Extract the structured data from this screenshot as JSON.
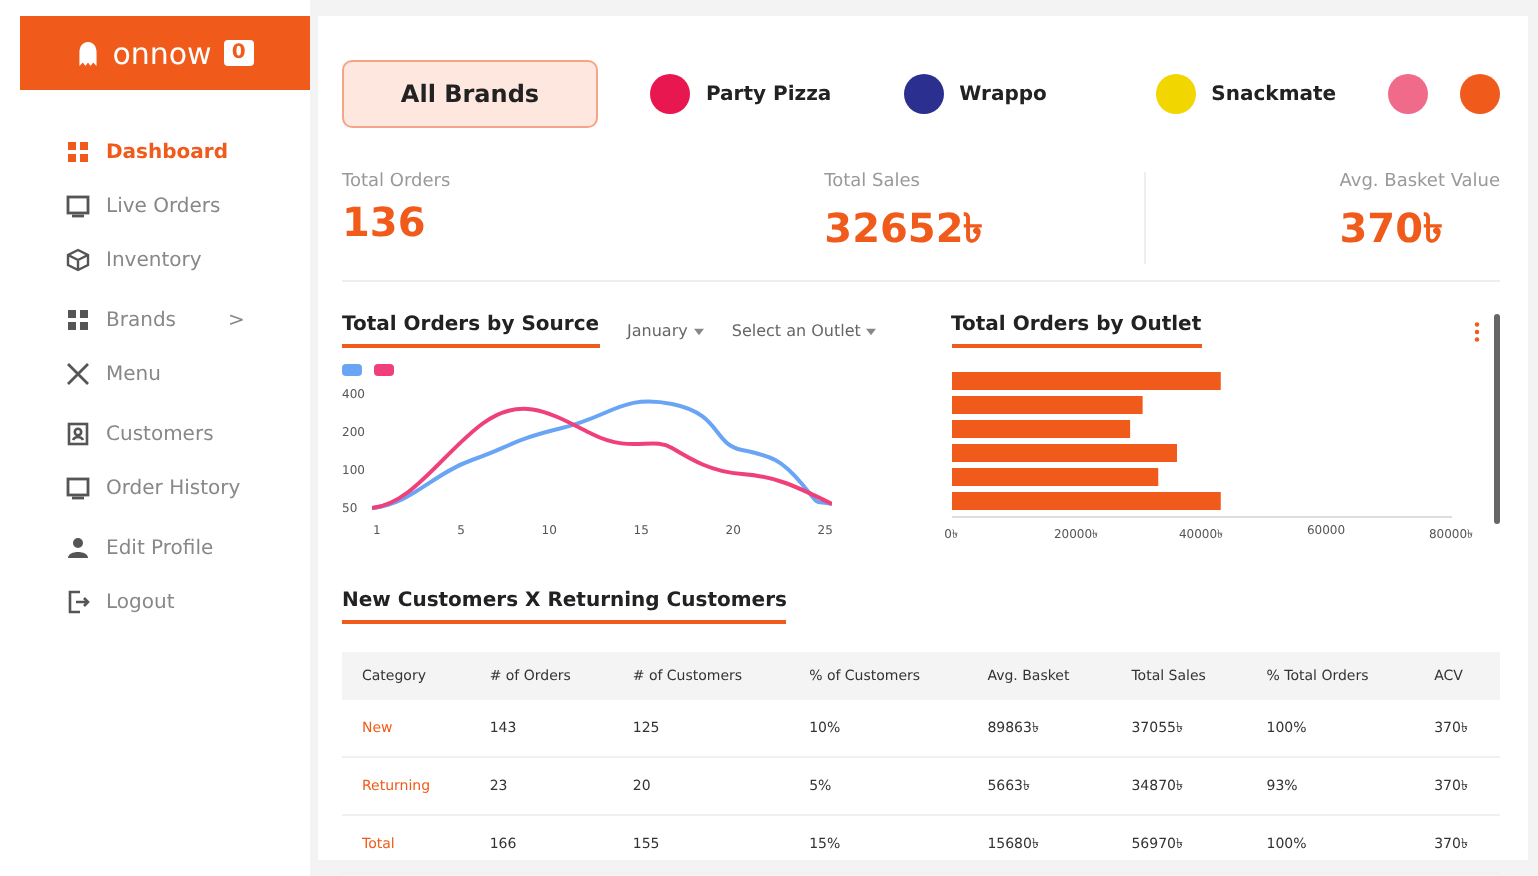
{
  "logo": {
    "name": "onnow",
    "badge": "0"
  },
  "sidebar": {
    "groups": [
      {
        "items": [
          {
            "label": "Dashboard",
            "selected": true
          },
          {
            "label": "Live Orders",
            "selected": false
          },
          {
            "label": "Inventory",
            "selected": false
          }
        ]
      },
      {
        "items": [
          {
            "label": "Brands",
            "selected": false,
            "chevron": ">"
          },
          {
            "label": "Menu",
            "selected": false
          }
        ]
      },
      {
        "items": [
          {
            "label": "Customers",
            "selected": false
          },
          {
            "label": "Order History",
            "selected": false
          }
        ]
      },
      {
        "items": [
          {
            "label": "Edit Profile",
            "selected": false
          },
          {
            "label": "Logout",
            "selected": false
          }
        ]
      }
    ]
  },
  "brands": [
    {
      "label": "All Brands",
      "selected": true
    },
    {
      "label": "Party Pizza",
      "selected": false,
      "color": "#e8174f"
    },
    {
      "label": "Wrappo",
      "selected": false,
      "color": "#2b2f8f"
    },
    {
      "label": "Snackmate",
      "selected": false,
      "color": "#f2d600"
    },
    {
      "selected": false,
      "color": "#f06b8a"
    },
    {
      "selected": false,
      "color": "#f05a1a"
    }
  ],
  "stats": [
    {
      "label": "Total Orders",
      "value": "136"
    },
    {
      "label": "Total Sales",
      "value": "32652৳"
    },
    {
      "label": "Avg. Basket Value",
      "value": "370৳"
    }
  ],
  "source_chart": {
    "title": "Total Orders by Source",
    "filters": [
      "January",
      "Select an Outlet"
    ],
    "y_ticks": [
      "400",
      "200",
      "100",
      "50"
    ],
    "x_ticks": [
      "1",
      "5",
      "10",
      "15",
      "20",
      "25"
    ]
  },
  "outlet_chart": {
    "title": "Total Orders by Outlet",
    "chart_data": {
      "type": "bar",
      "orientation": "horizontal",
      "categories": [
        null,
        null,
        null,
        null,
        null,
        null
      ],
      "xlim": [
        0,
        80000
      ],
      "xticks": [
        {
          "value": 0,
          "label": "0৳"
        },
        {
          "value": 20000,
          "label": "20000৳"
        },
        {
          "value": 40000,
          "label": "40000৳"
        },
        {
          "value": 60000,
          "label": "60000"
        },
        {
          "value": 80000,
          "label": "80000৳"
        }
      ],
      "series": [
        {
          "color": "#f05a1a",
          "values": [
            43000,
            30500,
            28500,
            36000,
            33000,
            43000
          ]
        }
      ]
    }
  },
  "customers_table": {
    "title": "New Customers X Returning Customers",
    "columns": [
      "Category",
      "# of Orders",
      "# of Customers",
      "% of Customers",
      "Avg. Basket",
      "Total Sales",
      "% Total Orders",
      "ACV"
    ],
    "rows": [
      [
        "New",
        "143",
        "125",
        "10%",
        "89863৳",
        "37055৳",
        "100%",
        "370৳"
      ],
      [
        "Returning",
        "23",
        "20",
        "5%",
        "5663৳",
        "34870৳",
        "93%",
        "370৳"
      ],
      [
        "Total",
        "166",
        "155",
        "15%",
        "15680৳",
        "56970৳",
        "100%",
        "370৳"
      ]
    ]
  }
}
